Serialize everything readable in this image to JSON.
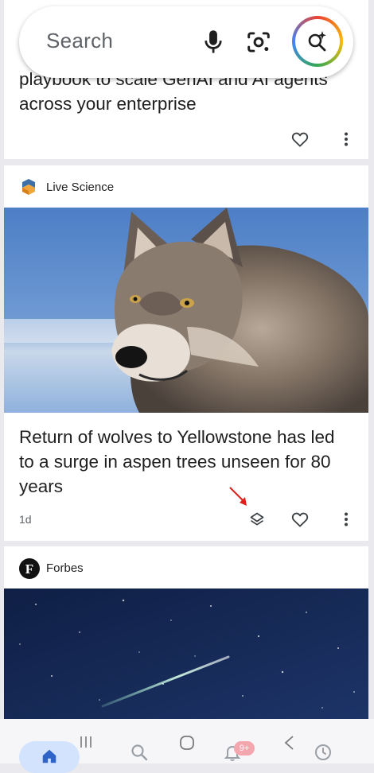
{
  "search": {
    "placeholder": "Search"
  },
  "cards": [
    {
      "title": "playbook to scale GenAI and AI agents across your enterprise"
    },
    {
      "source": "Live Science",
      "title": "Return of wolves to Yellowstone has led to a surge in aspen trees unseen for 80 years",
      "age": "1d"
    },
    {
      "source": "Forbes",
      "source_logo_letter": "F"
    }
  ],
  "bottom_nav": {
    "items": [
      "home",
      "search",
      "notifications",
      "collections"
    ],
    "notification_badge": "9+"
  },
  "colors": {
    "accent_home_bg": "#d3e3fd",
    "badge": "#f3a6ad",
    "top_pill": "#c2520f"
  }
}
